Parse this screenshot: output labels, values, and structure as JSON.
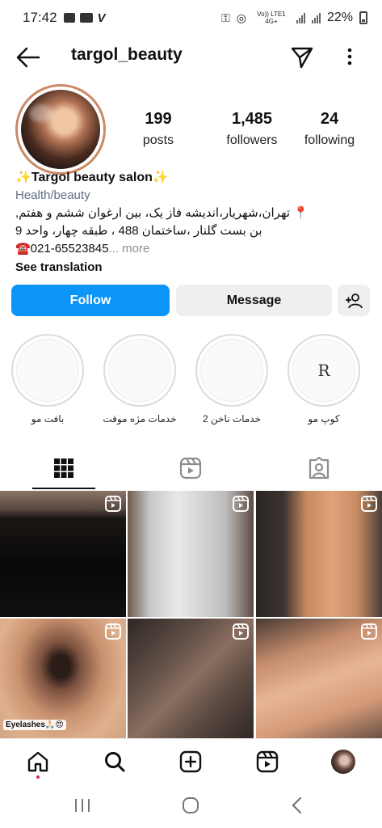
{
  "status_bar": {
    "time": "17:42",
    "network": "Vo)) LTE1 4G+",
    "battery": "22%"
  },
  "header": {
    "username": "targol_beauty"
  },
  "stats": {
    "posts_count": "199",
    "posts_label": "posts",
    "followers_count": "1,485",
    "followers_label": "followers",
    "following_count": "24",
    "following_label": "following"
  },
  "bio": {
    "name": "✨Targol beauty salon✨",
    "category": "Health/beauty",
    "line1": "📍 تهران،شهریار،اندیشه فاز یک، بین ارغوان ششم و هفتم,",
    "line2": "بن بست گلنار ،ساختمان 488 ، طبقه چهار، واحد 9",
    "phone": "☎️021-65523845",
    "more": "... more",
    "see_translation": "See translation"
  },
  "actions": {
    "follow": "Follow",
    "message": "Message"
  },
  "highlights": [
    {
      "label": "بافت مو",
      "text": ""
    },
    {
      "label": "خدمات مژه موقت",
      "text": ""
    },
    {
      "label": "خدمات ناخن 2",
      "text": ""
    },
    {
      "label": "کوپ مو",
      "text": "R"
    }
  ],
  "grid": {
    "posts": [
      {
        "overlay": ""
      },
      {
        "overlay": ""
      },
      {
        "overlay": ""
      },
      {
        "overlay": "Eyelashes🙏🏻😍"
      },
      {
        "overlay": ""
      },
      {
        "overlay": ""
      }
    ]
  },
  "colors": {
    "follow_button": "#0b95f6",
    "secondary_button": "#efefef",
    "avatar_ring": "#c98a65",
    "category_text": "#5f6f86"
  },
  "icons": {
    "back": "arrow-left-icon",
    "send": "send-icon",
    "more": "more-vertical-icon",
    "add_user": "add-user-icon",
    "grid_tab": "grid-icon",
    "reels_tab": "reels-icon",
    "tagged_tab": "tagged-icon",
    "home": "home-icon",
    "search": "search-icon",
    "create": "plus-square-icon",
    "reels": "reels-icon"
  }
}
